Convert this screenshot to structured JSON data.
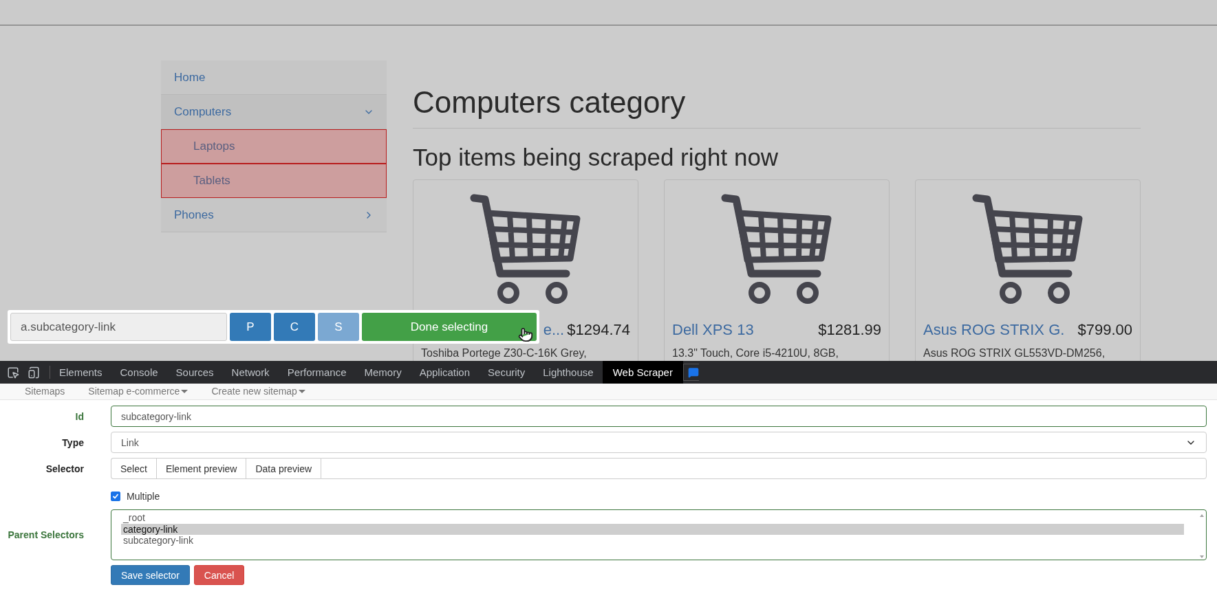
{
  "page": {
    "sidebar": [
      {
        "label": "Home",
        "kind": "top",
        "highlighted": false
      },
      {
        "label": "Computers",
        "kind": "top",
        "highlighted": false,
        "expanded": true
      },
      {
        "label": "Laptops",
        "kind": "sub",
        "highlighted": true
      },
      {
        "label": "Tablets",
        "kind": "sub",
        "highlighted": true
      },
      {
        "label": "Phones",
        "kind": "top",
        "highlighted": false,
        "expanded": false
      }
    ],
    "heading": "Computers category",
    "subheading": "Top items being scraped right now",
    "cards": [
      {
        "title": "e...",
        "price": "$1294.74",
        "description": "Toshiba Portege Z30-C-16K Grey,",
        "covered": true
      },
      {
        "title": "Dell XPS 13",
        "price": "$1281.99",
        "description": "13.3\" Touch, Core i5-4210U, 8GB,",
        "covered": false
      },
      {
        "title": "Asus ROG STRIX G.",
        "price": "$799.00",
        "description": "Asus ROG STRIX GL553VD-DM256,",
        "covered": false
      }
    ]
  },
  "selection_toolbar": {
    "selector": "a.subcategory-link",
    "buttons": [
      {
        "label": "P",
        "disabled": false
      },
      {
        "label": "C",
        "disabled": false
      },
      {
        "label": "S",
        "disabled": true
      }
    ],
    "done": "Done selecting"
  },
  "devtools": {
    "tabs": [
      {
        "label": "Elements",
        "selected": false
      },
      {
        "label": "Console",
        "selected": false
      },
      {
        "label": "Sources",
        "selected": false
      },
      {
        "label": "Network",
        "selected": false
      },
      {
        "label": "Performance",
        "selected": false
      },
      {
        "label": "Memory",
        "selected": false
      },
      {
        "label": "Application",
        "selected": false
      },
      {
        "label": "Security",
        "selected": false
      },
      {
        "label": "Lighthouse",
        "selected": false
      },
      {
        "label": "Web Scraper",
        "selected": true
      }
    ]
  },
  "scraper": {
    "nav": [
      {
        "label": "Sitemaps",
        "dropdown": false
      },
      {
        "label": "Sitemap e-commerce",
        "dropdown": true
      },
      {
        "label": "Create new sitemap",
        "dropdown": true
      }
    ],
    "id": {
      "label": "Id",
      "value": "subcategory-link",
      "valid": true
    },
    "type": {
      "label": "Type",
      "value": "Link",
      "valid": false
    },
    "selector": {
      "label": "Selector",
      "buttons": [
        "Select",
        "Element preview",
        "Data preview"
      ]
    },
    "multiple": {
      "label": "Multiple",
      "checked": true
    },
    "parent_selectors": {
      "label": "Parent Selectors",
      "valid": true,
      "options": [
        {
          "label": "_root",
          "selected": false
        },
        {
          "label": "category-link",
          "selected": true
        },
        {
          "label": "subcategory-link",
          "selected": false
        }
      ]
    },
    "actions": [
      {
        "label": "Save selector",
        "kind": "primary"
      },
      {
        "label": "Cancel",
        "kind": "danger"
      }
    ]
  }
}
